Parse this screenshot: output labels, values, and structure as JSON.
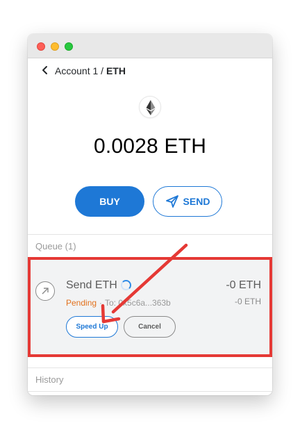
{
  "window": {
    "controls": [
      "close",
      "minimize",
      "maximize"
    ]
  },
  "header": {
    "account": "Account 1",
    "separator": " / ",
    "asset": "ETH"
  },
  "token": {
    "icon": "ethereum-icon",
    "balance": "0.0028",
    "symbol": "ETH"
  },
  "actions": {
    "buy_label": "BUY",
    "send_label": "SEND"
  },
  "queue": {
    "header": "Queue (1)",
    "transaction": {
      "title": "Send ETH",
      "status": "Pending",
      "separator": "·",
      "to": "To: 0x5c6a...363b",
      "amount": "-0 ETH",
      "amount_secondary": "-0 ETH",
      "speed_up_label": "Speed Up",
      "cancel_label": "Cancel"
    }
  },
  "history": {
    "header": "History"
  },
  "colors": {
    "accent": "#1e78d6",
    "pending": "#e2711d",
    "annotation": "#e53935"
  }
}
